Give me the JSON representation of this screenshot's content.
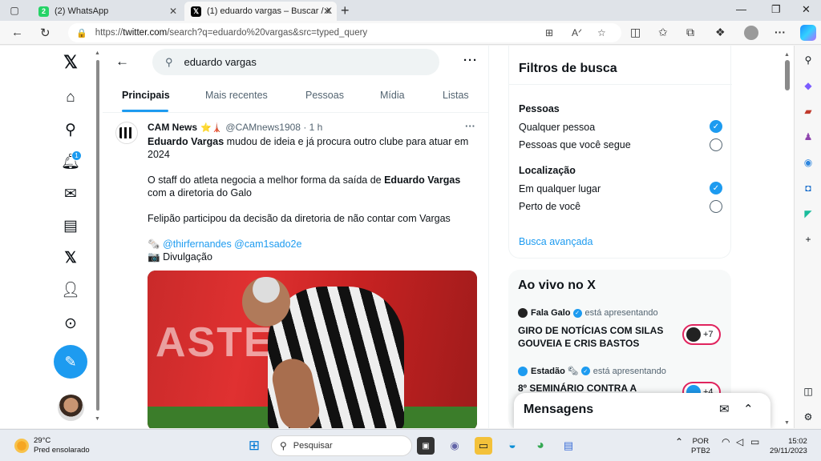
{
  "browser": {
    "tabs": [
      {
        "title": "(2) WhatsApp",
        "favicon": "whatsapp-icon",
        "badge": "2"
      },
      {
        "title": "(1) eduardo vargas – Buscar / X",
        "favicon": "x-logo-icon"
      }
    ],
    "url_prefix": "https://",
    "url_host": "twitter.com",
    "url_rest": "/search?q=eduardo%20vargas&src=typed_query"
  },
  "nav": {
    "notifications_badge": "1"
  },
  "search": {
    "query": "eduardo vargas",
    "tabs": [
      "Principais",
      "Mais recentes",
      "Pessoas",
      "Mídia",
      "Listas"
    ],
    "active_tab": "Principais"
  },
  "tweet": {
    "name": "CAM News",
    "emoji": "⭐🗼",
    "handle": "@CAMnews1908 · 1 h",
    "p1_bold": "Eduardo Vargas",
    "p1_rest": " mudou de ideia e já procura outro clube para atuar em 2024",
    "p2_start": "O staff do atleta negocia a melhor forma da saída de ",
    "p2_bold": "Eduardo Vargas",
    "p2_end": " com a diretoria do Galo",
    "p3": "Felipão participou da decisão da diretoria de não contar com Vargas",
    "credit_emoji": "🗞️",
    "credit_links": "@thirfernandes @cam1sado2e",
    "photo_emoji": "📷",
    "photo_credit": "Divulgação"
  },
  "filters": {
    "title": "Filtros de busca",
    "people_heading": "Pessoas",
    "people_options": [
      "Qualquer pessoa",
      "Pessoas que você segue"
    ],
    "people_selected": 0,
    "location_heading": "Localização",
    "location_options": [
      "Em qualquer lugar",
      "Perto de você"
    ],
    "location_selected": 0,
    "advanced": "Busca avançada"
  },
  "live": {
    "title": "Ao vivo no X",
    "items": [
      {
        "host": "Fala Galo",
        "status": "está apresentando",
        "title": "GIRO DE NOTÍCIAS COM SILAS GOUVEIA E CRIS BASTOS",
        "count": "+7"
      },
      {
        "host": "Estadão",
        "status": "está apresentando",
        "title": "8º SEMINÁRIO CONTRA A",
        "count": "+4"
      }
    ]
  },
  "messages": {
    "title": "Mensagens"
  },
  "taskbar": {
    "temp": "29°C",
    "weather": "Pred ensolarado",
    "search_placeholder": "Pesquisar",
    "lang1": "POR",
    "lang2": "PTB2",
    "time": "15:02",
    "date": "29/11/2023"
  }
}
